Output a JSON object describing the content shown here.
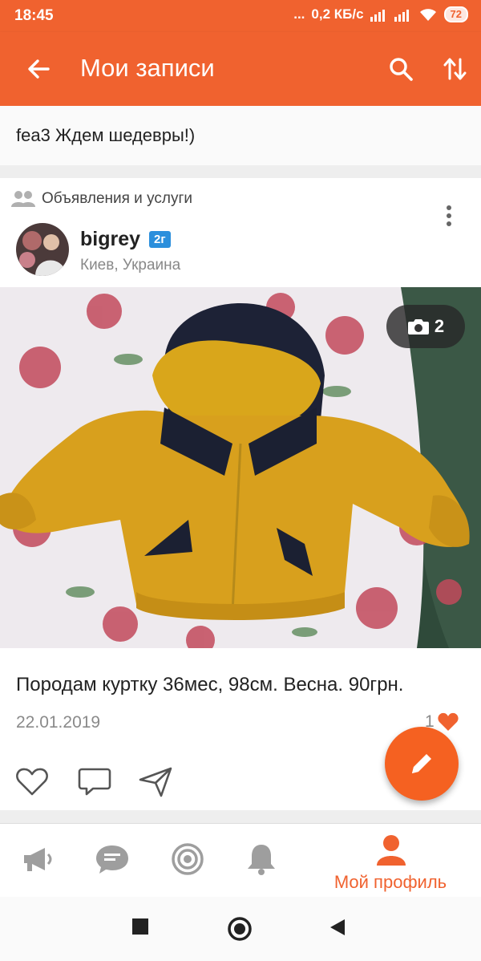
{
  "status_bar": {
    "time": "18:45",
    "dots": "...",
    "network_speed": "0,2 КБ/с",
    "battery": "72"
  },
  "app_bar": {
    "title": "Мои записи",
    "icons": [
      "back-arrow-icon",
      "search-icon",
      "sort-icon"
    ]
  },
  "status_line": "fea3 Ждем шедевры!)",
  "post": {
    "group": "Объявления и услуги",
    "author": "bigrey",
    "author_badge": "2г",
    "location": "Киев, Украина",
    "photo_count": "2",
    "text": "Породам куртку 36мес, 98см. Весна. 90грн.",
    "date": "22.01.2019",
    "likes": "1",
    "actions": [
      "like-icon",
      "comment-icon",
      "share-icon"
    ]
  },
  "colors": {
    "brand": "#f0622f",
    "fab": "#f56121",
    "badge": "#2b8fdc",
    "like": "#f0622f"
  },
  "bottom_nav": {
    "items": [
      "megaphone-icon",
      "messages-icon",
      "target-icon",
      "bell-icon"
    ],
    "active_label": "Мой профиль"
  }
}
